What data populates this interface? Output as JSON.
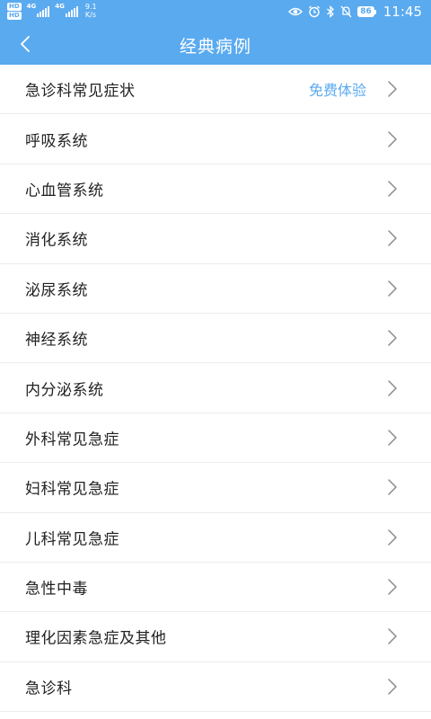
{
  "status_bar": {
    "hd_label": "HD",
    "network_label_1": "4G",
    "network_label_2": "4G",
    "speed_value": "9.1",
    "speed_unit": "K/s",
    "battery_level": "86",
    "time": "11:45",
    "icons": [
      "eye-icon",
      "alarm-icon",
      "bluetooth-icon",
      "mute-icon",
      "battery-icon"
    ]
  },
  "header": {
    "title": "经典病例",
    "back_icon": "chevron-left-icon",
    "background_color": "#5aaaf0"
  },
  "list": {
    "items": [
      {
        "label": "急诊科常见症状",
        "badge": "免费体验"
      },
      {
        "label": "呼吸系统",
        "badge": ""
      },
      {
        "label": "心血管系统",
        "badge": ""
      },
      {
        "label": "消化系统",
        "badge": ""
      },
      {
        "label": "泌尿系统",
        "badge": ""
      },
      {
        "label": "神经系统",
        "badge": ""
      },
      {
        "label": "内分泌系统",
        "badge": ""
      },
      {
        "label": "外科常见急症",
        "badge": ""
      },
      {
        "label": "妇科常见急症",
        "badge": ""
      },
      {
        "label": "儿科常见急症",
        "badge": ""
      },
      {
        "label": "急性中毒",
        "badge": ""
      },
      {
        "label": "理化因素急症及其他",
        "badge": ""
      },
      {
        "label": "急诊科",
        "badge": ""
      }
    ],
    "chevron_icon": "chevron-right-icon",
    "badge_color": "#5aaaf0"
  }
}
